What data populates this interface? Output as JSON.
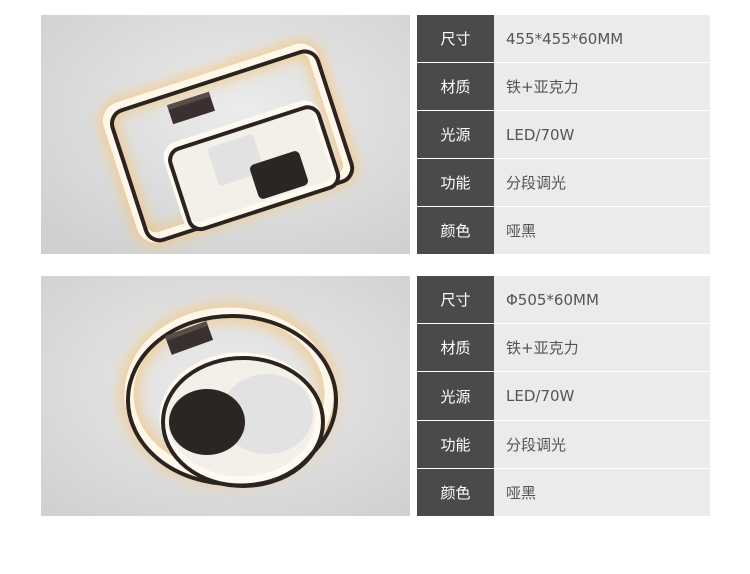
{
  "products": [
    {
      "shape": "square",
      "specs": [
        {
          "key": "尺寸",
          "value": "455*455*60MM"
        },
        {
          "key": "材质",
          "value": "铁+亚克力"
        },
        {
          "key": "光源",
          "value": "LED/70W"
        },
        {
          "key": "功能",
          "value": "分段调光"
        },
        {
          "key": "颜色",
          "value": "哑黑"
        }
      ]
    },
    {
      "shape": "round",
      "specs": [
        {
          "key": "尺寸",
          "value": "Φ505*60MM"
        },
        {
          "key": "材质",
          "value": "铁+亚克力"
        },
        {
          "key": "光源",
          "value": "LED/70W"
        },
        {
          "key": "功能",
          "value": "分段调光"
        },
        {
          "key": "颜色",
          "value": "哑黑"
        }
      ]
    }
  ],
  "colors": {
    "key_bg": "#4a4a4a",
    "value_bg": "#ebebeb",
    "photo_bg": "#dcdcdc"
  }
}
